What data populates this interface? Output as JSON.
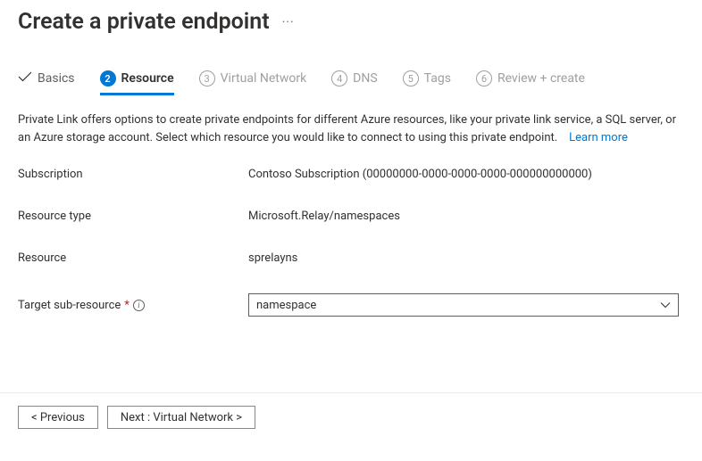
{
  "page": {
    "title": "Create a private endpoint"
  },
  "tabs": {
    "basics": {
      "label": "Basics"
    },
    "resource": {
      "num": "2",
      "label": "Resource"
    },
    "virtualNetwork": {
      "num": "3",
      "label": "Virtual Network"
    },
    "dns": {
      "num": "4",
      "label": "DNS"
    },
    "tags": {
      "num": "5",
      "label": "Tags"
    },
    "review": {
      "num": "6",
      "label": "Review + create"
    }
  },
  "description": {
    "text": "Private Link offers options to create private endpoints for different Azure resources, like your private link service, a SQL server, or an Azure storage account. Select which resource you would like to connect to using this private endpoint.",
    "learnMore": "Learn more"
  },
  "form": {
    "subscription": {
      "label": "Subscription",
      "value": "Contoso Subscription (00000000-0000-0000-0000-000000000000)"
    },
    "resourceType": {
      "label": "Resource type",
      "value": "Microsoft.Relay/namespaces"
    },
    "resource": {
      "label": "Resource",
      "value": "sprelayns"
    },
    "targetSubResource": {
      "label": "Target sub-resource",
      "value": "namespace"
    }
  },
  "footer": {
    "previous": "< Previous",
    "next": "Next : Virtual Network >"
  }
}
